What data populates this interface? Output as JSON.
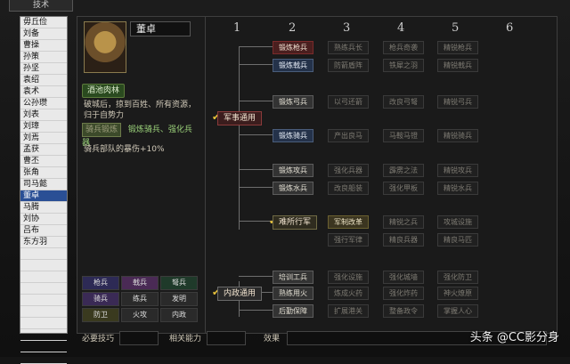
{
  "window": {
    "title": "技术"
  },
  "list": {
    "items": [
      "毋丘俭",
      "刘备",
      "曹操",
      "孙策",
      "孙坚",
      "袁绍",
      "袁术",
      "公孙瓒",
      "刘表",
      "刘璋",
      "刘焉",
      "孟获",
      "曹丕",
      "张角",
      "司马懿",
      "董卓",
      "马腾",
      "刘协",
      "吕布",
      "东方羽",
      "",
      "",
      "",
      "",
      "",
      "",
      "",
      "",
      "",
      ""
    ],
    "selected_index": 15
  },
  "character": {
    "name": "董卓",
    "skill_name": "酒池肉林",
    "skill_desc_line1": "破城后，掠到百姓、所有资源，",
    "skill_desc_line2": "归于自势力",
    "combo_chip": "骑兵锻炼",
    "combo_text": "锻炼骑兵、强化兵器",
    "bonus": "骑兵部队的暴伤+10%"
  },
  "categories": {
    "r1": [
      "枪兵",
      "戟兵",
      "弩兵"
    ],
    "r2": [
      "骑兵",
      "练兵",
      "发明"
    ],
    "r3": [
      "防卫",
      "火攻",
      "内政"
    ]
  },
  "tree": {
    "columns": [
      "1",
      "2",
      "3",
      "4",
      "5",
      "6"
    ],
    "branches": [
      "军事通用",
      "难所行军",
      "内政通用"
    ],
    "row1": [
      "锻炼枪兵",
      "熟练兵长",
      "枪兵奇袭",
      "精锐枪兵"
    ],
    "row2": [
      "锻炼戟兵",
      "防箭盾阵",
      "铁犀之羽",
      "精锐戟兵"
    ],
    "row3": [
      "锻炼弓兵",
      "以弓还箭",
      "改良弓弩",
      "精锐弓兵"
    ],
    "row4": [
      "锻炼骑兵",
      "产出良马",
      "马鞍马镫",
      "精锐骑兵"
    ],
    "row5": [
      "锻炼攻兵",
      "强化兵器",
      "霹雳之法",
      "精锐攻兵"
    ],
    "row6": [
      "锻炼水兵",
      "改良船装",
      "强化甲板",
      "精锐水兵"
    ],
    "row7": [
      "军制改革",
      "精锐之兵",
      "攻城设施"
    ],
    "row8": [
      "强行军律",
      "精良兵器",
      "精良马匹"
    ],
    "row9": [
      "培训工兵",
      "强化设施",
      "强化城墙",
      "强化防卫"
    ],
    "row10": [
      "熟练用火",
      "炼成火药",
      "强化炸药",
      "神火燎原"
    ],
    "row11": [
      "后勤保障",
      "扩展港关",
      "整备政令",
      "掌握人心"
    ]
  },
  "bottom": {
    "label1": "必要技巧",
    "label2": "相关能力",
    "label3": "效果"
  },
  "watermark": "头条 @CC影分身"
}
